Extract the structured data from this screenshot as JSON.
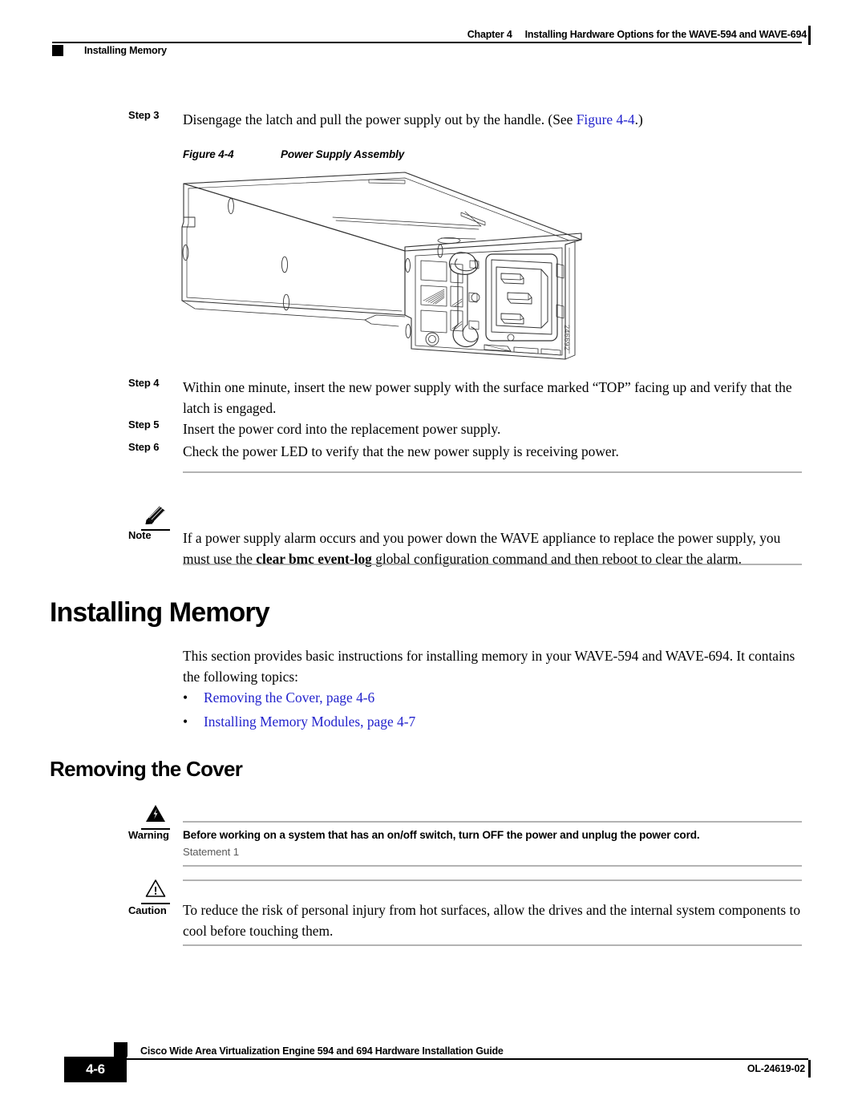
{
  "header": {
    "chapter": "Chapter 4",
    "chapter_title": "Installing Hardware Options for the WAVE-594 and WAVE-694",
    "running_head": "Installing Memory"
  },
  "steps": [
    {
      "label": "Step 3",
      "text_before": "Disengage the latch and pull the power supply out by the handle. (See ",
      "link": "Figure 4-4",
      "text_after": ".)"
    },
    {
      "label": "Step 4",
      "text": "Within one minute, insert the new power supply with the surface marked “TOP” facing up and verify that the latch is engaged."
    },
    {
      "label": "Step 5",
      "text": "Insert the power cord into the replacement power supply."
    },
    {
      "label": "Step 6",
      "text": "Check the power LED to verify that the new power supply is receiving power."
    }
  ],
  "figure": {
    "number": "Figure 4-4",
    "title": "Power Supply Assembly",
    "art_id": "246692",
    "alt": "Isometric line drawing of a hot-swappable power supply module showing the chassis body, front face with vent grilles, S-shaped pull handle, IEC power inlet socket and status LED"
  },
  "note": {
    "label": "Note",
    "icon": "pencil-icon",
    "text_part1": "If a power supply alarm occurs and you power down the WAVE appliance to replace the power supply, you must use the ",
    "command": "clear bmc event-log",
    "text_part2": " global configuration command and then reboot to clear the alarm."
  },
  "section": {
    "heading": "Installing Memory",
    "intro": "This section provides basic instructions for installing memory in your WAVE-594 and WAVE-694. It contains the following topics:",
    "bullet_char": "•",
    "links": [
      "Removing the Cover, page 4-6",
      "Installing Memory Modules, page 4-7"
    ]
  },
  "subsection": {
    "heading": "Removing the Cover"
  },
  "warning": {
    "label": "Warning",
    "icon": "warning-triangle-icon",
    "text": "Before working on a system that has an on/off switch, turn OFF the power and unplug the power cord.",
    "statement": "Statement 1"
  },
  "caution": {
    "label": "Caution",
    "icon": "caution-triangle-icon",
    "text": "To reduce the risk of personal injury from hot surfaces, allow the drives and the internal system components to cool before touching them."
  },
  "footer": {
    "page_number": "4-6",
    "doc_title": "Cisco Wide Area Virtualization Engine 594 and 694 Hardware Installation Guide",
    "doc_id": "OL-24619-02"
  },
  "colors": {
    "link": "#2222cc",
    "rule_gray": "#b3b3b3",
    "text": "#000000"
  }
}
